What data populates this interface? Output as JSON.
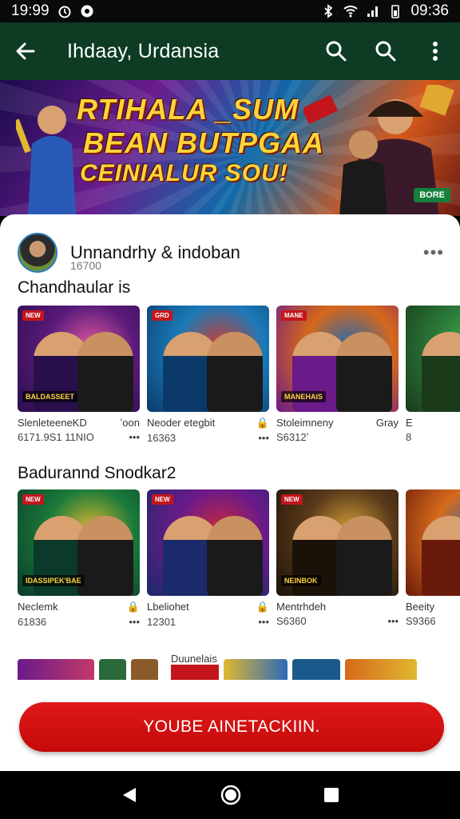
{
  "status_bar": {
    "time_left": "19:99",
    "time_right": "09:36"
  },
  "app_bar": {
    "title": "Ihdaay, Urdansia"
  },
  "banner": {
    "line1": "RTIHALA _SUM",
    "line2": "BEAN BUTPGAA",
    "line3": "CEINIALUR SOU!",
    "tag": "BORE"
  },
  "developer": {
    "name": "Unnandrhy & indoban",
    "subtitle": "16700",
    "more": "•••"
  },
  "section1": {
    "title": "Chandhaular is",
    "cards": [
      {
        "badge": "NEW",
        "caption": "BALDASSEET",
        "name": "SlenleteeneKD",
        "aside": "ʼoon",
        "meta": "6171.9S1 11NIO",
        "meta_aside": "•••",
        "colors": [
          "#5a1a7a",
          "#2a0f4d",
          "#e25aa0"
        ]
      },
      {
        "badge": "GRD",
        "caption": "",
        "name": "Neoder etegbit",
        "aside": "🔒",
        "meta": "16363",
        "meta_aside": "•••",
        "colors": [
          "#1a7ab8",
          "#0b3a6a",
          "#d83a2a"
        ]
      },
      {
        "badge": "MANE",
        "caption": "MANEHAIS",
        "name": "Stoleimneny",
        "aside": "Gray",
        "meta": "S6312ʼ",
        "meta_aside": "",
        "colors": [
          "#d6681b",
          "#6b1a8a",
          "#1a6ab8"
        ]
      },
      {
        "badge": "",
        "caption": "",
        "name": "E",
        "aside": "",
        "meta": "8",
        "meta_aside": "",
        "colors": [
          "#2a7a3a",
          "#1a3a1a",
          "#4ab84a"
        ]
      }
    ]
  },
  "section2": {
    "title": "Badurannd Snodkar2",
    "cards": [
      {
        "badge": "NEW",
        "caption": "IDASSIPEK'BAE",
        "name": "Neclemk",
        "aside": "🔒",
        "meta": "61836",
        "meta_aside": "•••",
        "colors": [
          "#1a7a3a",
          "#0b3a2a",
          "#e0b830"
        ]
      },
      {
        "badge": "NEW",
        "caption": "",
        "name": "Lbeliohet",
        "aside": "🔒",
        "meta": "12301",
        "meta_aside": "•••",
        "colors": [
          "#6a1a8a",
          "#1a2a6a",
          "#c82a3a"
        ]
      },
      {
        "badge": "NEW",
        "caption": "NEINBOK",
        "name": "Mentrhdeh",
        "aside": "",
        "meta": "S6360",
        "meta_aside": "•••",
        "colors": [
          "#5a3a1a",
          "#1a1208",
          "#d6a23a"
        ]
      },
      {
        "badge": "",
        "caption": "",
        "name": "Beeity",
        "aside": "",
        "meta": "S9366",
        "meta_aside": "",
        "colors": [
          "#d66a1b",
          "#6a1a0a",
          "#2a6ab8"
        ]
      }
    ]
  },
  "strip_label": "Duunelais",
  "cta": {
    "label": "YOUBE AINETACKIIN."
  }
}
